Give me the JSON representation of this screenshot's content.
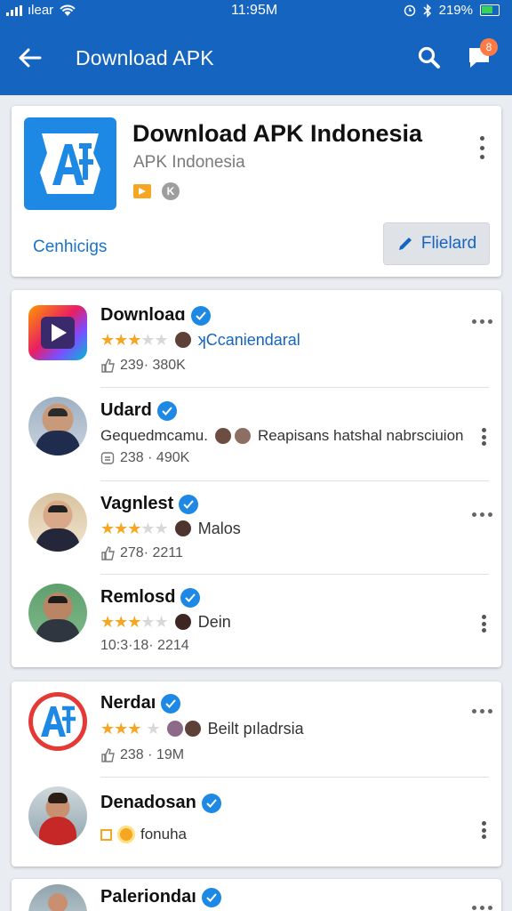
{
  "status": {
    "carrier": "ılear",
    "time": "11:95M",
    "battery": "219%"
  },
  "appbar": {
    "title": "Download APK",
    "notification_count": "8"
  },
  "hero": {
    "title": "Download APK Indonesia",
    "subtitle": "APK  Indonesia",
    "badge_letter": "K",
    "link_label": "Cenhicigs",
    "button_label": "Flielard"
  },
  "list1": [
    {
      "name": "Downloaɑ",
      "rating": 3,
      "extra": "ʞCcaniendaral",
      "stats": "239· 380K"
    },
    {
      "name": "Udard",
      "extra_left": "Gequedmcamu.",
      "extra": "Reapisans hatshal nabrsciuion",
      "stats": "238 · 490K"
    },
    {
      "name": "Vagnlest",
      "rating": 3,
      "extra": "Malos",
      "stats": "278· 2211"
    },
    {
      "name": "Remlosd",
      "rating": 3,
      "extra": "Dein",
      "stats": "10:3·18· 2214"
    }
  ],
  "list2": [
    {
      "name": "Nerdaı",
      "rating": 3,
      "extra": "Beilt pıladrsia",
      "stats": "238 · 19M"
    },
    {
      "name": "Denadosan",
      "extra": "fonuha"
    }
  ],
  "list3": [
    {
      "name": "Paleriondaı"
    }
  ],
  "colors": {
    "primary": "#1565c0",
    "accent": "#f5a623",
    "verified": "#1e88e5"
  }
}
